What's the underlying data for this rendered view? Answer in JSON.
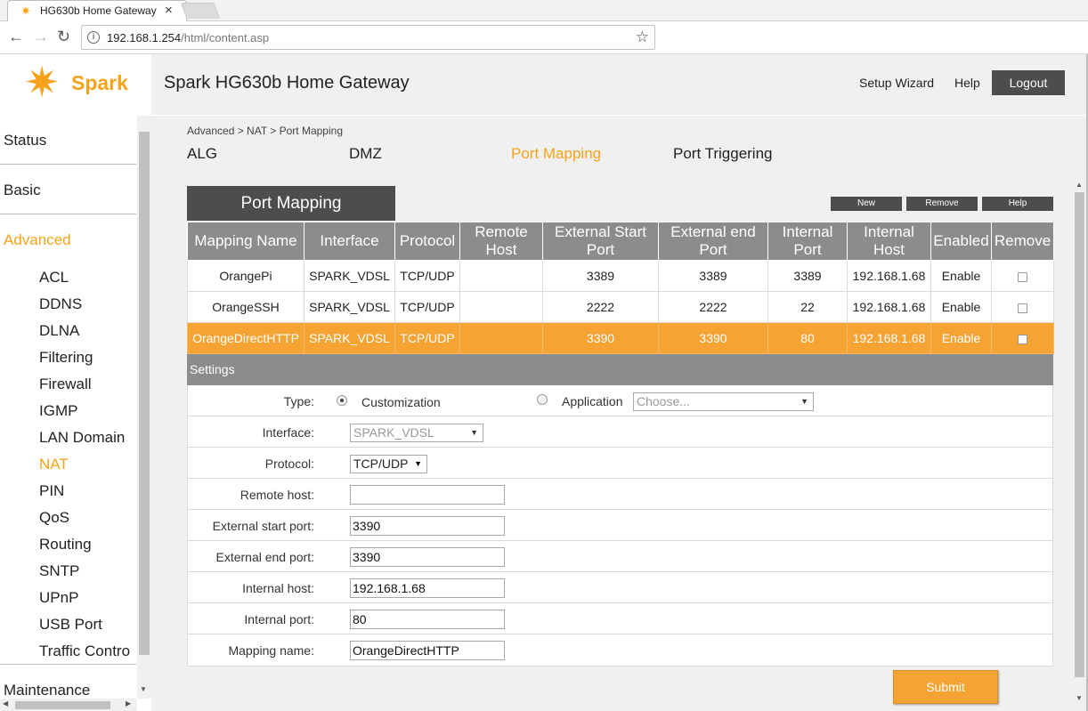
{
  "browser": {
    "tab_title": "HG630b Home Gateway",
    "tab_close_glyph": "×",
    "favicon": "spark-star-icon",
    "url_host": "192.168.1.254",
    "url_path": "/html/content.asp",
    "back_glyph": "←",
    "forward_glyph": "→",
    "reload_glyph": "↻",
    "star_glyph": "☆",
    "info_glyph": "i"
  },
  "header": {
    "logo_text": "Spark",
    "logo_glyph": "✷",
    "title": "Spark HG630b Home Gateway",
    "setup_wizard": "Setup Wizard",
    "help": "Help",
    "logout": "Logout",
    "accent_color": "#f5a31a"
  },
  "sidebar": {
    "status": "Status",
    "basic": "Basic",
    "advanced": "Advanced",
    "maintenance": "Maintenance",
    "sub_items": [
      "ACL",
      "DDNS",
      "DLNA",
      "Filtering",
      "Firewall",
      "IGMP",
      "LAN Domain",
      "NAT",
      "PIN",
      "QoS",
      "Routing",
      "SNTP",
      "UPnP",
      "USB Port",
      "Traffic Contro"
    ],
    "active_main": "Advanced",
    "active_sub": "NAT"
  },
  "main": {
    "breadcrumb": "Advanced > NAT > Port Mapping",
    "tabs": [
      "ALG",
      "DMZ",
      "Port Mapping",
      "Port Triggering"
    ],
    "active_tab": "Port Mapping",
    "section_title": "Port Mapping",
    "buttons": {
      "new": "New",
      "remove": "Remove",
      "help": "Help"
    },
    "table": {
      "headers": [
        "Mapping Name",
        "Interface",
        "Protocol",
        "Remote Host",
        "External Start Port",
        "External end Port",
        "Internal Port",
        "Internal Host",
        "Enabled",
        "Remove"
      ],
      "rows": [
        [
          "OrangePi",
          "SPARK_VDSL",
          "TCP/UDP",
          "",
          "3389",
          "3389",
          "3389",
          "192.168.1.68",
          "Enable"
        ],
        [
          "OrangeSSH",
          "SPARK_VDSL",
          "TCP/UDP",
          "",
          "2222",
          "2222",
          "22",
          "192.168.1.68",
          "Enable"
        ],
        [
          "OrangeDirectHTTP",
          "SPARK_VDSL",
          "TCP/UDP",
          "",
          "3390",
          "3390",
          "80",
          "192.168.1.68",
          "Enable"
        ]
      ],
      "selected_row": 2,
      "selected_color": "#f5a333"
    },
    "settings": {
      "bar_title": "Settings",
      "type_label": "Type:",
      "type_customization": "Customization",
      "type_application": "Application",
      "type_selected": "Customization",
      "application_select": "Choose...",
      "interface_label": "Interface:",
      "interface_value": "SPARK_VDSL",
      "protocol_label": "Protocol:",
      "protocol_value": "TCP/UDP",
      "remote_host_label": "Remote host:",
      "remote_host_value": "",
      "ext_start_label": "External start port:",
      "ext_start_value": "3390",
      "ext_end_label": "External end port:",
      "ext_end_value": "3390",
      "internal_host_label": "Internal host:",
      "internal_host_value": "192.168.1.68",
      "internal_port_label": "Internal port:",
      "internal_port_value": "80",
      "mapping_name_label": "Mapping name:",
      "mapping_name_value": "OrangeDirectHTTP"
    },
    "submit": "Submit"
  }
}
